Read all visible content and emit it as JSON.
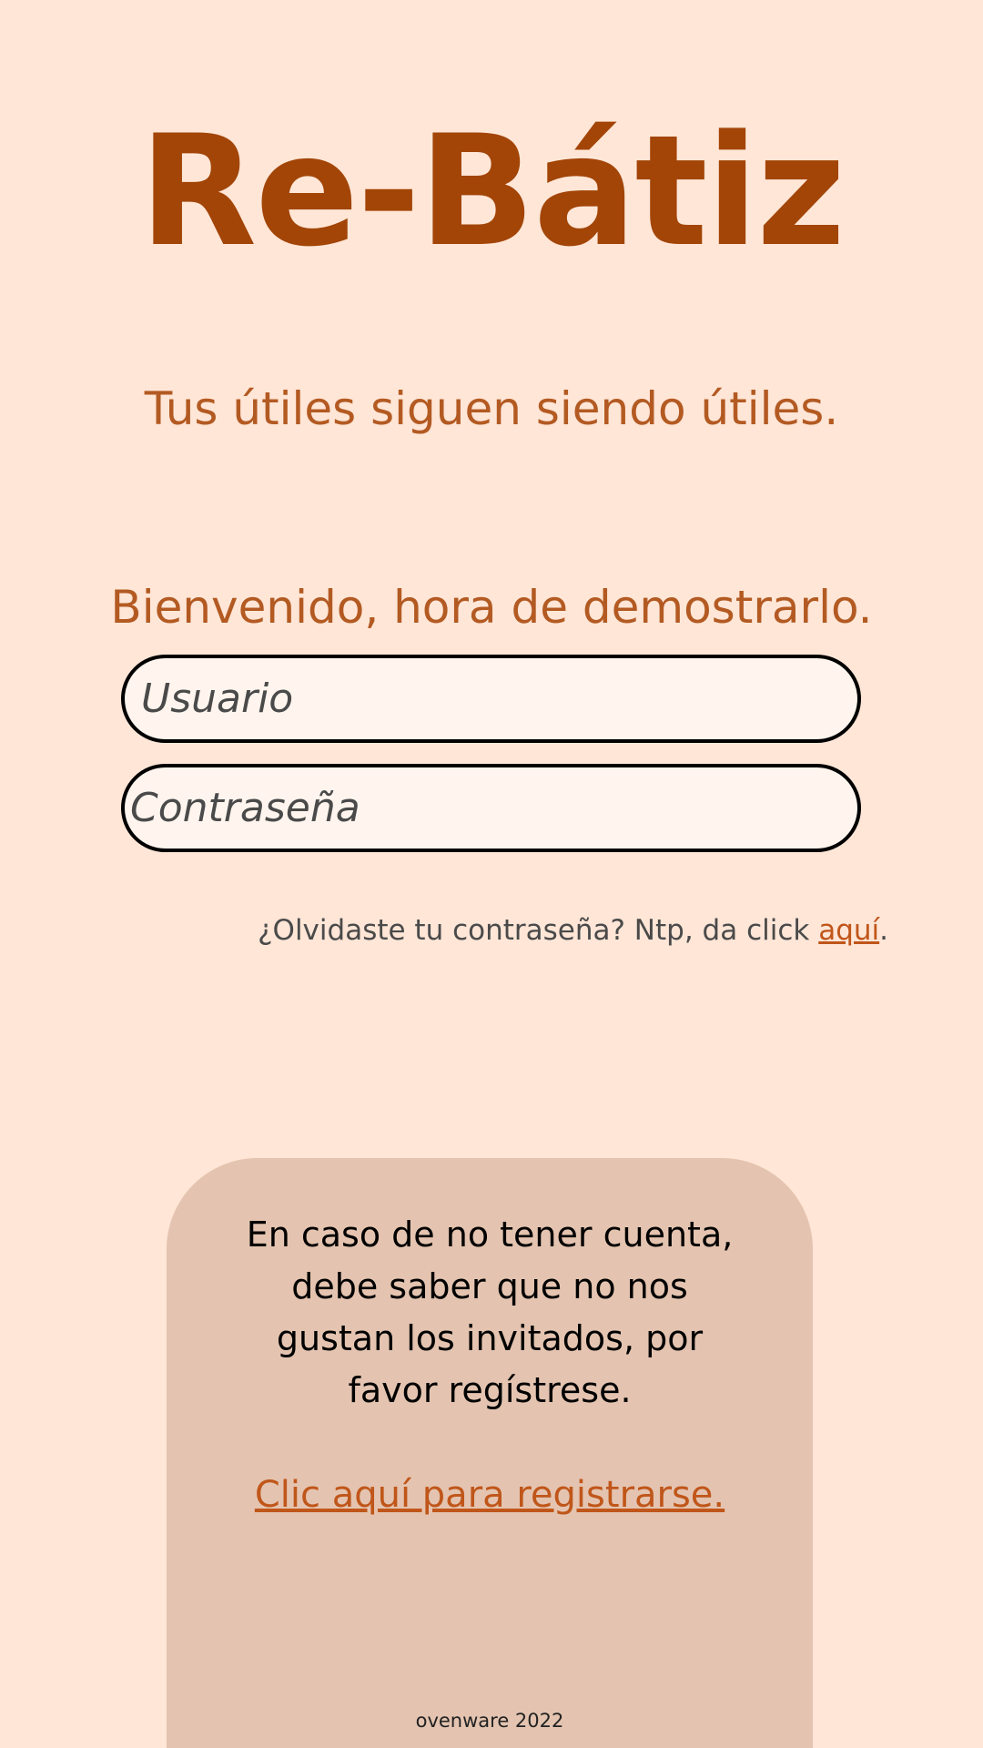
{
  "header": {
    "brand": "Re-Bátiz",
    "tagline": "Tus útiles siguen siendo útiles."
  },
  "login": {
    "welcome": "Bienvenido, hora de demostrarlo.",
    "username_placeholder": "Usuario",
    "password_placeholder": "Contraseña",
    "forgot_prefix": "¿Olvidaste tu contraseña? Ntp, da click ",
    "forgot_link": "aquí",
    "forgot_suffix": "."
  },
  "register": {
    "message": "En caso de no tener cuenta, debe saber que no nos gustan los invitados, por favor regístrese.",
    "link": "Clic aquí para registrarse."
  },
  "footer": {
    "text": "ovenware 2022"
  },
  "colors": {
    "background": "#ffe6d7",
    "brand": "#a24507",
    "accent": "#b35a22",
    "link": "#c0561a",
    "card": "#e4c4b0",
    "input_fill": "#fff5ee"
  }
}
